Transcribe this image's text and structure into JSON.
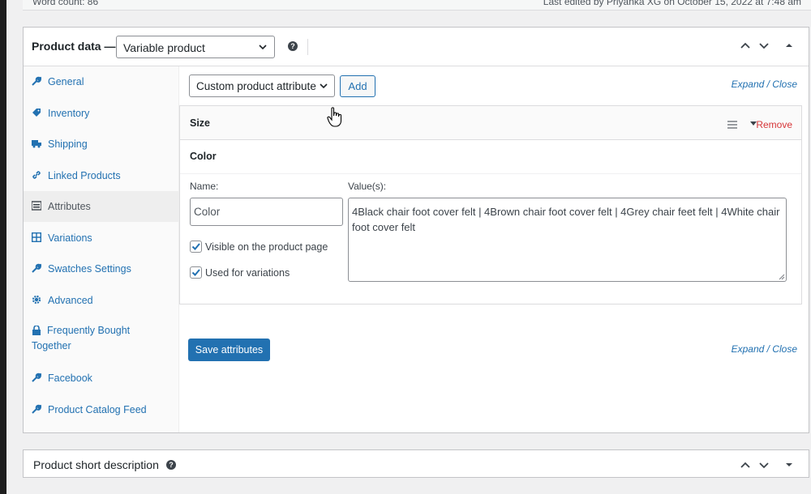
{
  "topbar": {
    "word_count": "Word count: 86",
    "last_edited": "Last edited by Priyanka XG on October 15, 2022 at 7:48 am"
  },
  "product_data": {
    "title": "Product data —",
    "type_value": "Variable product",
    "help_glyph": "?",
    "ctrl_up": "∧",
    "ctrl_down": "∨",
    "ctrl_toggle": "▲"
  },
  "sidebar": {
    "items": [
      {
        "label": "General",
        "icon": "wrench-icon"
      },
      {
        "label": "Inventory",
        "icon": "tag-icon"
      },
      {
        "label": "Shipping",
        "icon": "truck-icon"
      },
      {
        "label": "Linked Products",
        "icon": "link-icon"
      },
      {
        "label": "Attributes",
        "icon": "list-icon"
      },
      {
        "label": "Variations",
        "icon": "grid-icon"
      },
      {
        "label": "Swatches Settings",
        "icon": "wrench-icon"
      },
      {
        "label": "Advanced",
        "icon": "gear-icon"
      },
      {
        "label": "Frequently Bought Together",
        "icon": "lock-icon"
      },
      {
        "label": "Facebook",
        "icon": "wrench-icon"
      },
      {
        "label": "Product Catalog Feed",
        "icon": "wrench-icon"
      }
    ]
  },
  "attributes": {
    "select_value": "Custom product attribute",
    "add_label": "Add",
    "expand_close": "Expand / Close",
    "size_title": "Size",
    "remove_label": "Remove",
    "color_title": "Color",
    "name_label": "Name:",
    "name_value": "Color",
    "values_label": "Value(s):",
    "values_value": "4Black chair foot cover felt | 4Brown chair foot cover felt | 4Grey chair feet felt | 4White chair foot cover felt",
    "visible_label": "Visible on the product page",
    "variations_label": "Used for variations",
    "save_label": "Save attributes"
  },
  "short_description": {
    "title": "Product short description"
  }
}
